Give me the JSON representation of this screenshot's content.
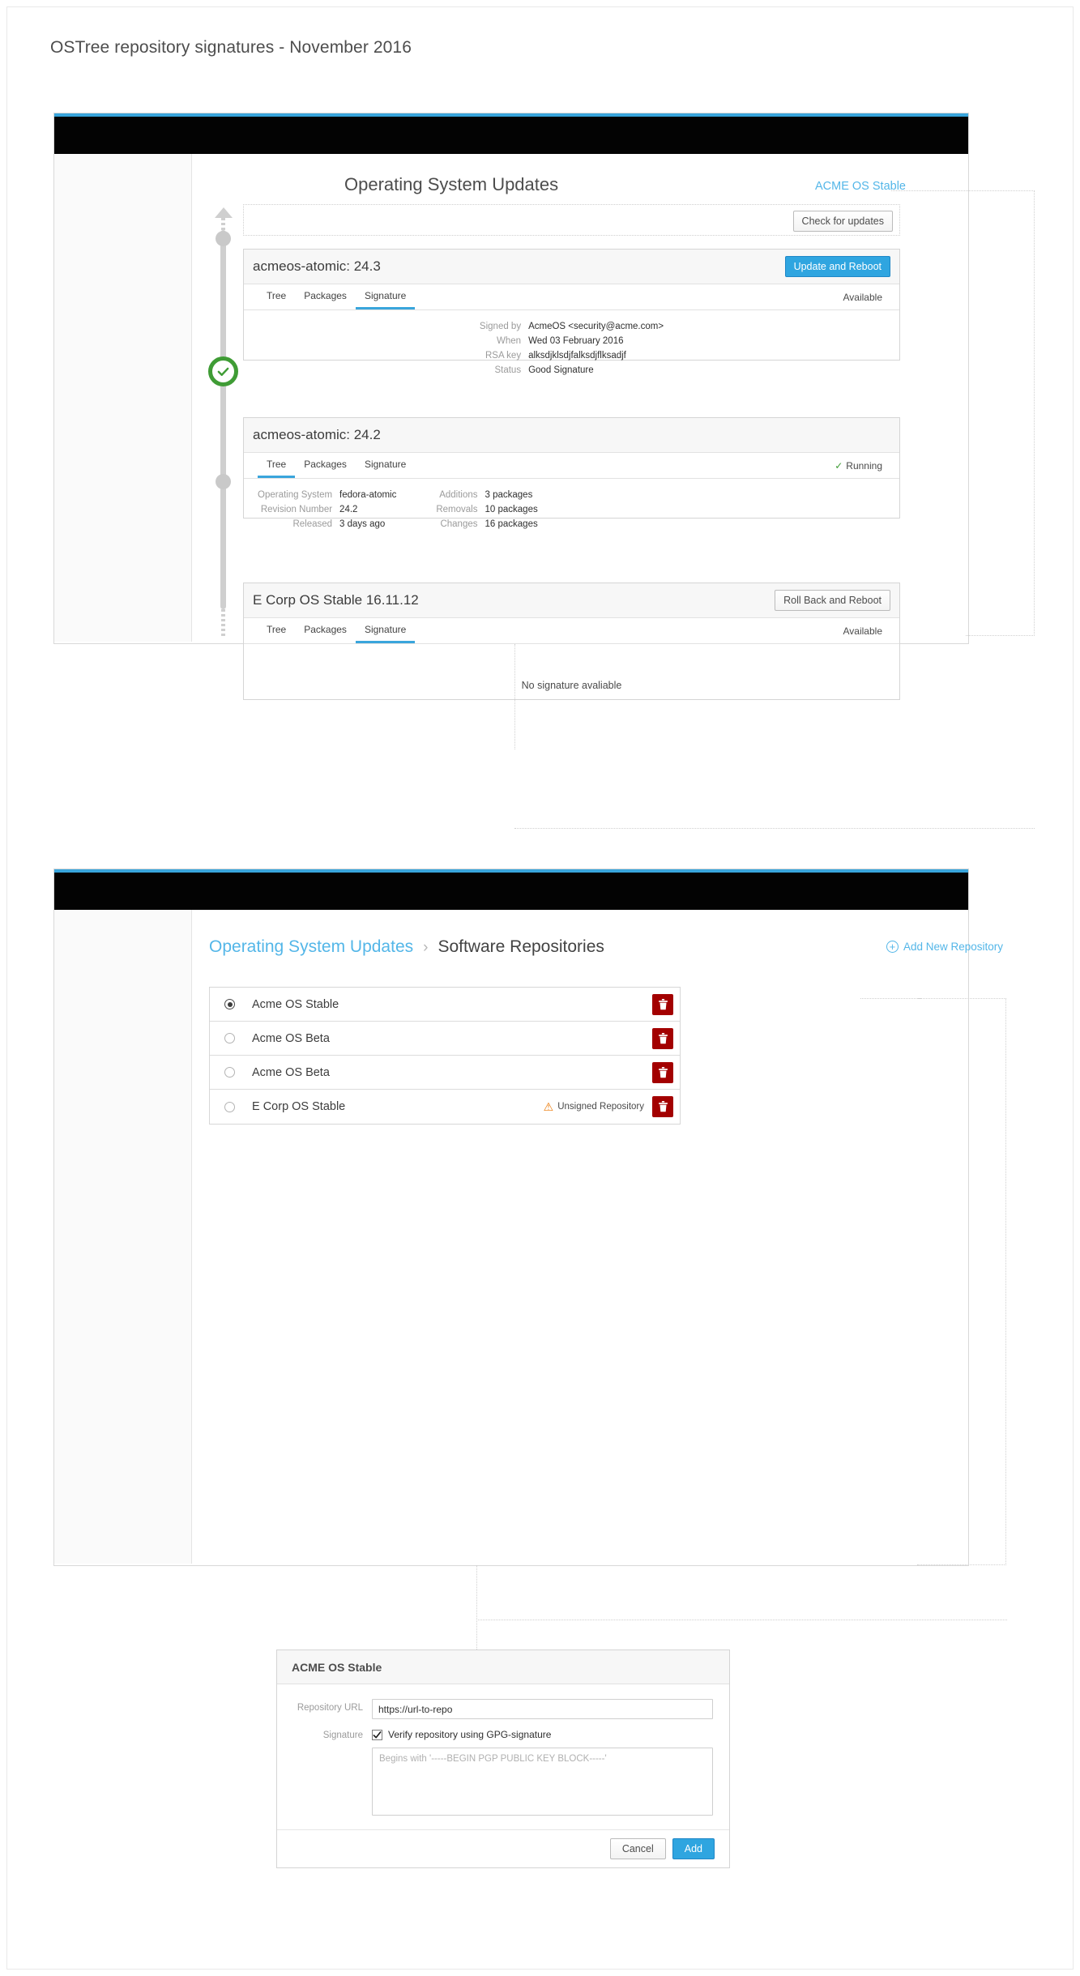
{
  "page": {
    "title": "OSTree repository signatures - November 2016"
  },
  "colors": {
    "accent": "#39a5dc",
    "link": "#53b6e8",
    "primary_btn": "#2fa5e0",
    "success": "#3f9c35",
    "danger": "#a30000",
    "warning": "#ec7a08",
    "topbar": "#030303"
  },
  "panel1": {
    "heading": "Operating System Updates",
    "repo_link": "ACME OS Stable",
    "check_updates_label": "Check for updates",
    "cards": [
      {
        "title": "acmeos-atomic: 24.3",
        "action_label": "Update and Reboot",
        "action_style": "primary",
        "tabs": [
          "Tree",
          "Packages",
          "Signature"
        ],
        "active_tab": "Signature",
        "status": "Available",
        "status_icon": "",
        "details": [
          {
            "key": "Signed by",
            "value": "AcmeOS <security@acme.com>"
          },
          {
            "key": "When",
            "value": "Wed 03 February 2016"
          },
          {
            "key": "RSA key",
            "value": "alksdjklsdjfalksdjflksadjf"
          },
          {
            "key": "Status",
            "value": "Good Signature"
          }
        ]
      },
      {
        "title": "acmeos-atomic: 24.2",
        "action_label": "",
        "action_style": "none",
        "tabs": [
          "Tree",
          "Packages",
          "Signature"
        ],
        "active_tab": "Tree",
        "status": "Running",
        "status_icon": "check-circle-icon",
        "details_left": [
          {
            "key": "Operating System",
            "value": "fedora-atomic"
          },
          {
            "key": "Revision Number",
            "value": "24.2"
          },
          {
            "key": "Released",
            "value": "3 days ago"
          }
        ],
        "details_right": [
          {
            "key": "Additions",
            "value": "3 packages"
          },
          {
            "key": "Removals",
            "value": "10 packages"
          },
          {
            "key": "Changes",
            "value": "16 packages"
          }
        ]
      },
      {
        "title": "E Corp OS Stable 16.11.12",
        "action_label": "Roll Back and Reboot",
        "action_style": "default",
        "tabs": [
          "Tree",
          "Packages",
          "Signature"
        ],
        "active_tab": "Signature",
        "status": "Available",
        "status_icon": "",
        "empty_message": "No signature avaliable"
      }
    ]
  },
  "panel2": {
    "breadcrumb_parent": "Operating System Updates",
    "breadcrumb_sep": "›",
    "breadcrumb_current": "Software Repositories",
    "add_repo_label": "Add New Repository",
    "repositories": [
      {
        "name": "Acme OS Stable",
        "selected": true,
        "warning": ""
      },
      {
        "name": "Acme OS Beta",
        "selected": false,
        "warning": ""
      },
      {
        "name": "Acme OS Beta",
        "selected": false,
        "warning": ""
      },
      {
        "name": "E Corp OS Stable",
        "selected": false,
        "warning": "Unsigned Repository"
      }
    ]
  },
  "dialog": {
    "title": "ACME OS Stable",
    "url_label": "Repository URL",
    "url_value": "https://url-to-repo",
    "signature_label": "Signature",
    "verify_checkbox_label": "Verify repository using GPG-signature",
    "verify_checked": true,
    "key_placeholder": "Begins with '-----BEGIN PGP PUBLIC KEY BLOCK-----'",
    "key_value": "",
    "cancel_label": "Cancel",
    "add_label": "Add"
  }
}
